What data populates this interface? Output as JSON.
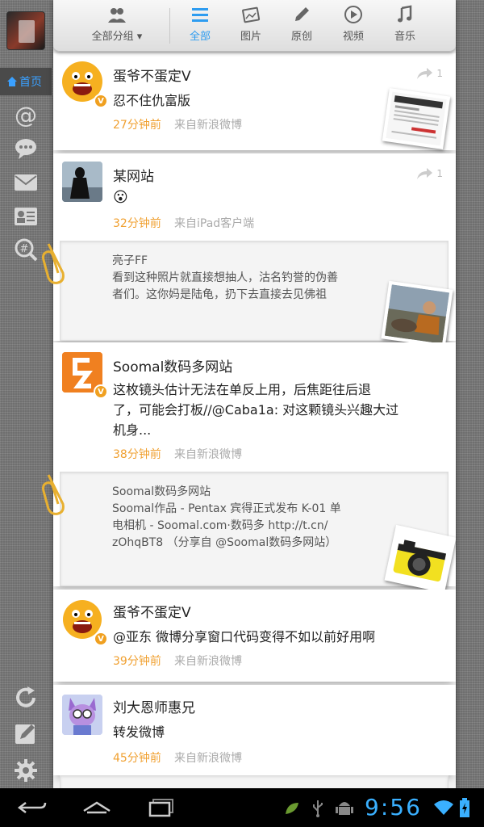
{
  "header": {
    "group_label": "全部分组 ▾",
    "tabs": [
      {
        "label": "全部",
        "icon": "list-icon",
        "active": true
      },
      {
        "label": "图片",
        "icon": "image-icon",
        "active": false
      },
      {
        "label": "原创",
        "icon": "pencil-icon",
        "active": false
      },
      {
        "label": "视频",
        "icon": "play-icon",
        "active": false
      },
      {
        "label": "音乐",
        "icon": "music-icon",
        "active": false
      }
    ]
  },
  "sidebar": {
    "home_label": "首页",
    "items": [
      "mention-icon",
      "comment-icon",
      "mail-icon",
      "contact-card-icon",
      "hashtag-search-icon"
    ],
    "bottom": [
      "refresh-icon",
      "compose-icon",
      "settings-icon"
    ]
  },
  "posts": [
    {
      "username": "蛋爷不蛋定V",
      "text": "忍不住仇富版",
      "time": "27分钟前",
      "source": "来自新浪微博",
      "retweet_count": "1",
      "verified": true
    },
    {
      "username": "某网站",
      "text": "😮",
      "time": "32分钟前",
      "source": "来自iPad客户端",
      "retweet_count": "1",
      "verified": false,
      "quote": {
        "author": "亮子FF",
        "lines": [
          "看到这种照片就直接想抽人，沽名钓誉的伪善",
          "者们。这你妈是陆龟，扔下去直接去见佛祖"
        ]
      }
    },
    {
      "username": "Soomal数码多网站",
      "text_lines": [
        "这枚镜头估计无法在单反上用，后焦距往后退",
        "了，可能会打板//@Caba1a: 对这颗镜头兴趣大过",
        "机身..."
      ],
      "time": "38分钟前",
      "source": "来自新浪微博",
      "verified": true,
      "quote": {
        "author": "Soomal数码多网站",
        "lines": [
          "Soomal作品 - Pentax 宾得正式发布 K-01 单",
          "电相机  - Soomal.com·数码多 http://t.cn/",
          "zOhqBT8  （分享自 @Soomal数码多网站）"
        ]
      }
    },
    {
      "username": "蛋爷不蛋定V",
      "text": "@亚东 微博分享窗口代码变得不如以前好用啊",
      "time": "39分钟前",
      "source": "来自新浪微博",
      "verified": true
    },
    {
      "username": "刘大恩师惠兄",
      "text": "转发微博",
      "time": "45分钟前",
      "source": "来自新浪微博",
      "verified": false
    }
  ],
  "statusbar": {
    "clock": "9:56"
  }
}
